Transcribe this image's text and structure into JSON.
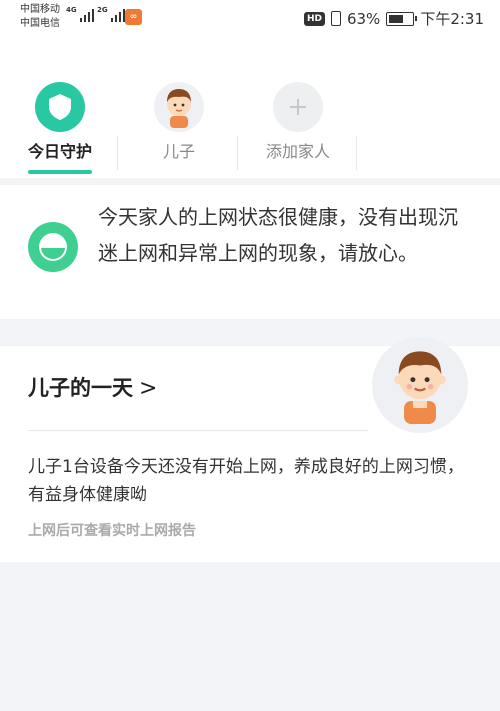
{
  "status_bar": {
    "carrier_1": "中国移动",
    "carrier_2": "中国电信",
    "net_1": "4G",
    "net_2": "2G",
    "hd": "HD",
    "battery_percent": "63%",
    "battery_level": 63,
    "time": "下午2:31"
  },
  "members": [
    {
      "label": "今日守护",
      "icon": "shield-icon",
      "active": true
    },
    {
      "label": "儿子",
      "icon": "boy-avatar",
      "active": false
    },
    {
      "label": "添加家人",
      "icon": "plus-icon",
      "active": false
    }
  ],
  "status_card": {
    "icon": "smile-face-icon",
    "message": "今天家人的上网状态很健康，没有出现沉迷上网和异常上网的现象，请放心。"
  },
  "day_card": {
    "title": "儿子的一天",
    "chevron": ">",
    "body": "儿子1台设备今天还没有开始上网，养成良好的上网习惯，有益身体健康呦",
    "hint": "上网后可查看实时上网报告"
  },
  "colors": {
    "accent": "#28c9a2",
    "face_green": "#3ecf91",
    "background": "#f2f4f7"
  }
}
